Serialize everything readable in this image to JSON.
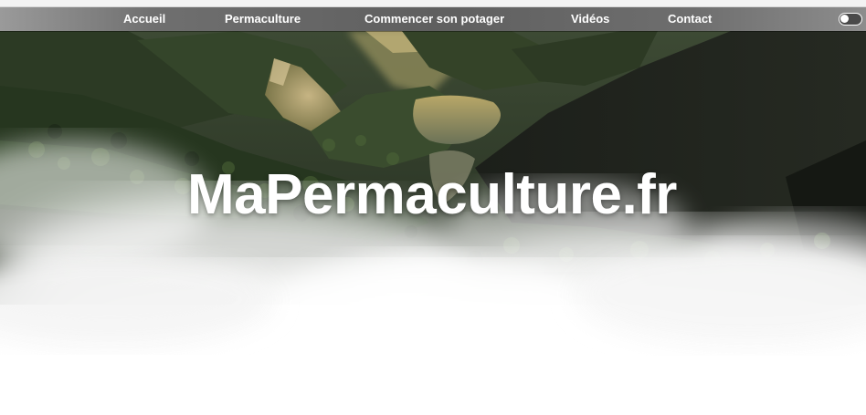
{
  "nav": {
    "items": [
      {
        "label": "Accueil"
      },
      {
        "label": "Permaculture"
      },
      {
        "label": "Commencer son potager"
      },
      {
        "label": "Vidéos"
      },
      {
        "label": "Contact"
      }
    ],
    "theme_toggle_icon": "toggle-switch-icon"
  },
  "hero": {
    "title": "MaPermaculture.fr",
    "background": "forested-valley-with-river-and-mist"
  },
  "colors": {
    "nav_bar": "#6a6a6a",
    "nav_text": "#ffffff",
    "title": "#ffffff",
    "forest_dark": "#1f2a1c",
    "mist": "#ffffff"
  }
}
